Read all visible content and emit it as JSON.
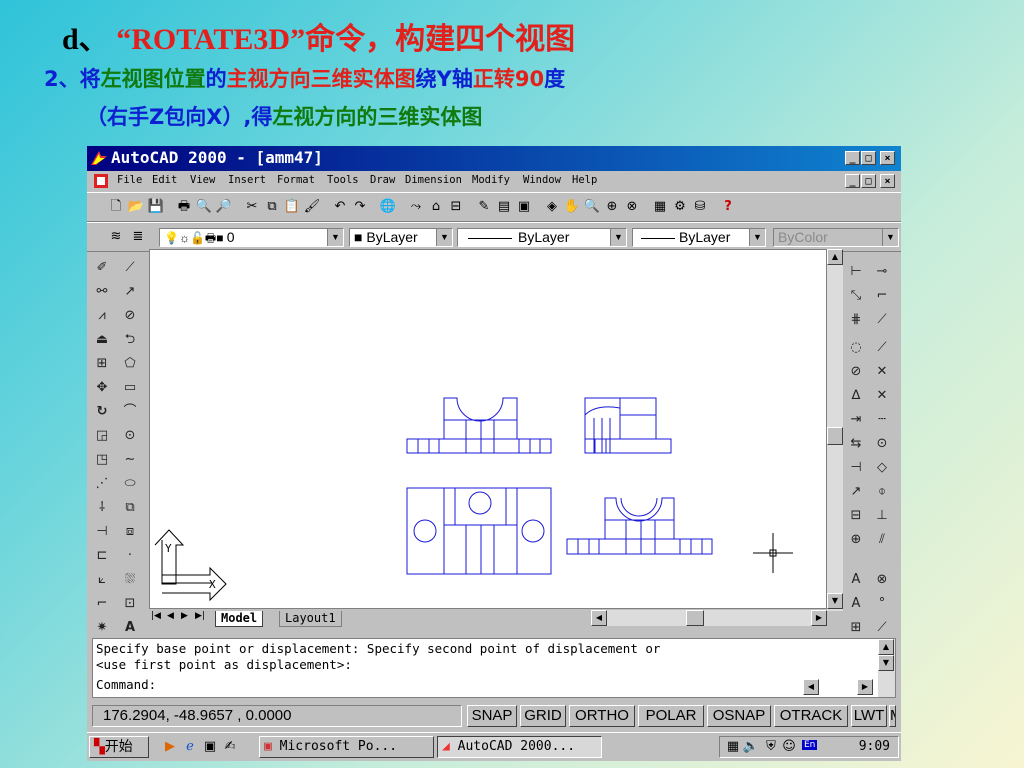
{
  "slide": {
    "title_prefix": "d、 ",
    "title_highlight": "“ROTATE3D”",
    "title_suffix": "命令，构建四个视图",
    "line1": [
      {
        "t": "2、将",
        "c": "blue"
      },
      {
        "t": "左视图位置",
        "c": "green"
      },
      {
        "t": "的",
        "c": "blue"
      },
      {
        "t": "主视方向三维实体图",
        "c": "red2"
      },
      {
        "t": "绕",
        "c": "blue"
      },
      {
        "t": "Y",
        "c": "blue"
      },
      {
        "t": "轴",
        "c": "blue"
      },
      {
        "t": "正转",
        "c": "red2"
      },
      {
        "t": "90",
        "c": "red2"
      },
      {
        "t": "度",
        "c": "blue"
      }
    ],
    "line2": [
      {
        "t": "（右手",
        "c": "blue"
      },
      {
        "t": "Z",
        "c": "blue"
      },
      {
        "t": "包向",
        "c": "blue"
      },
      {
        "t": "X",
        "c": "blue"
      },
      {
        "t": "）,得",
        "c": "blue"
      },
      {
        "t": "左视方向的三维实体图",
        "c": "green"
      }
    ]
  },
  "window": {
    "title": "AutoCAD 2000 - [amm47]",
    "min": "_",
    "max": "□",
    "close": "×"
  },
  "menu": [
    "File",
    "Edit",
    "View",
    "Insert",
    "Format",
    "Tools",
    "Draw",
    "Dimension",
    "Modify",
    "Window",
    "Help"
  ],
  "properties": {
    "layer": "0",
    "color": "ByLayer",
    "linetype": "ByLayer",
    "lineweight": "ByLayer",
    "plotstyle": "ByColor"
  },
  "tabs": {
    "model": "Model",
    "layout1": "Layout1"
  },
  "ucs": {
    "y": "Y",
    "x": "X"
  },
  "command": {
    "line1": "Specify base point or displacement: Specify second point of displacement or",
    "line2": "<use first point as displacement>:",
    "prompt": "Command:"
  },
  "status": {
    "coords": "176.2904,  -48.9657  , 0.0000",
    "buttons": [
      "SNAP",
      "GRID",
      "ORTHO",
      "POLAR",
      "OSNAP",
      "OTRACK",
      "LWT",
      "M"
    ]
  },
  "taskbar": {
    "start": "开始",
    "tasks": [
      "Microsoft Po...",
      "AutoCAD 2000..."
    ],
    "clock": "9:09",
    "lang": "En"
  },
  "colors": {
    "drawing_line": "#1a1ad8",
    "title_bar": "#000080",
    "title_red": "#e2211c",
    "text_blue": "#0c1fd1",
    "text_green": "#117a0f"
  }
}
